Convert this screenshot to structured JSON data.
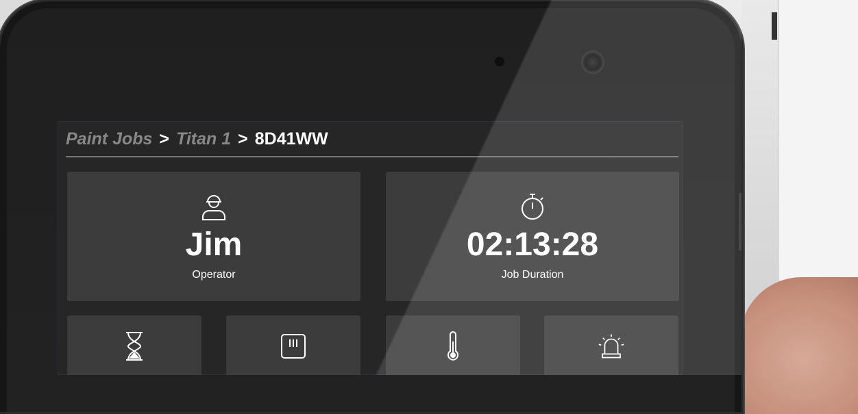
{
  "breadcrumb": {
    "items": [
      "Paint Jobs",
      "Titan 1"
    ],
    "separator": ">",
    "current": "8D41WW"
  },
  "tiles": {
    "operator": {
      "value": "Jim",
      "label": "Operator",
      "icon": "worker-helmet-icon"
    },
    "job_duration": {
      "value": "02:13:28",
      "label": "Job Duration",
      "icon": "stopwatch-icon"
    }
  },
  "small_tiles": [
    {
      "icon": "hourglass-icon"
    },
    {
      "icon": "paint-can-icon"
    },
    {
      "icon": "thermometer-icon"
    },
    {
      "icon": "alarm-siren-icon"
    }
  ],
  "colors": {
    "screen_bg": "#262626",
    "tile_bg": "#3c3c3c",
    "breadcrumb_link": "#888888",
    "text": "#ffffff"
  }
}
